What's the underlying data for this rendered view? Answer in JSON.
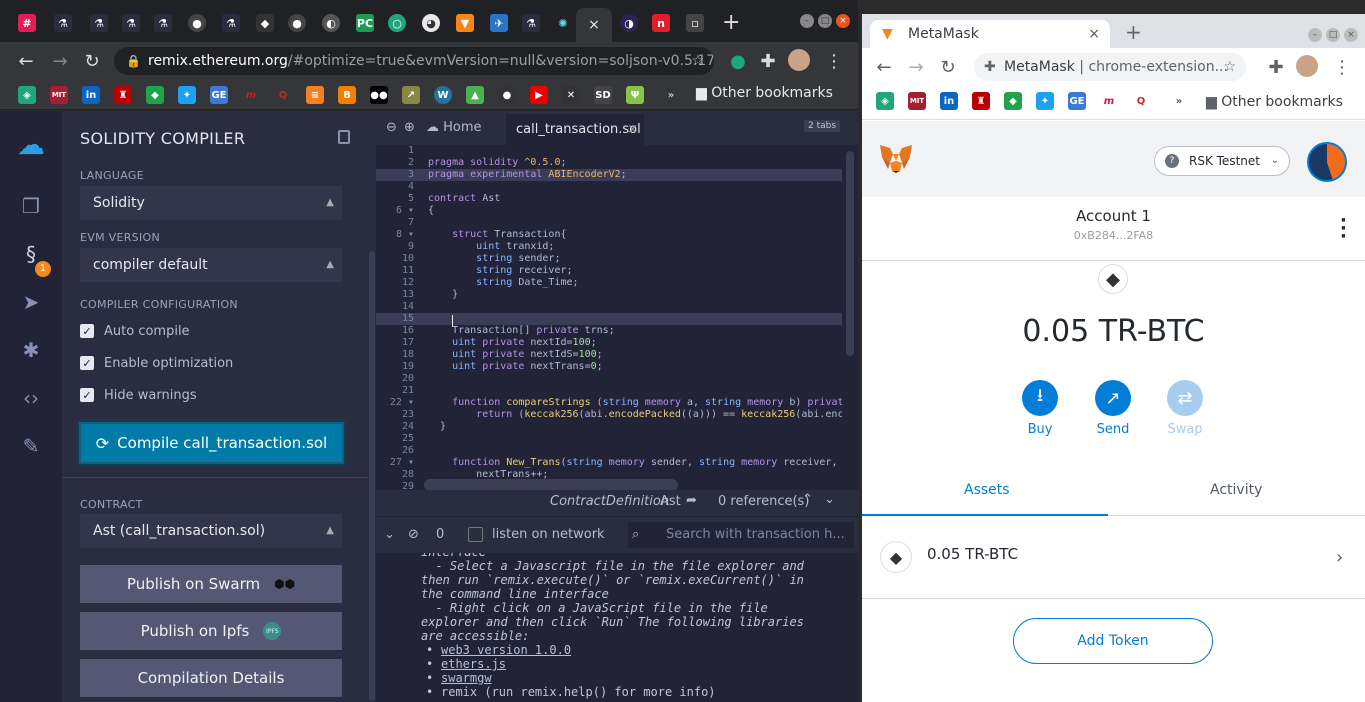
{
  "browser_left": {
    "url_domain": "remix.ethereum.org",
    "url_rest": "/#optimize=true&evmVersion=null&version=soljson-v0.5.17+...",
    "other_bookmarks": "Other bookmarks",
    "new_tab": "+",
    "close_tab": "×"
  },
  "remix": {
    "panel_title": "SOLIDITY COMPILER",
    "language_label": "LANGUAGE",
    "language_value": "Solidity",
    "evm_label": "EVM VERSION",
    "evm_value": "compiler default",
    "config_label": "COMPILER CONFIGURATION",
    "auto_compile": "Auto compile",
    "enable_optimization": "Enable optimization",
    "hide_warnings": "Hide warnings",
    "compile_button": "Compile call_transaction.sol",
    "contract_label": "CONTRACT",
    "contract_value": "Ast (call_transaction.sol)",
    "publish_swarm": "Publish on Swarm",
    "publish_ipfs": "Publish on Ipfs",
    "ipfs_badge": "IPFS",
    "compilation_details": "Compilation Details",
    "plugin_badge": "1"
  },
  "editor": {
    "home_tab": "Home",
    "file_tab": "call_transaction.sol",
    "tabs_count": "2 tabs",
    "contract_definition_label": "ContractDefinition",
    "contract_definition_name": "Ast",
    "references": "0 reference(s)",
    "terminal_count": "0",
    "listen_label": "listen on network",
    "search_placeholder": "Search with transaction h..."
  },
  "terminal_lines": [
    "interface",
    "  - Select a Javascript file in the file explorer and",
    "then run `remix.execute()` or `remix.exeCurrent()` in",
    "the command line interface",
    "  - Right click on a JavaScript file in the file",
    "explorer and then click `Run` The following libraries",
    "are accessible:",
    "web3 version 1.0.0",
    "ethers.js",
    "swarmgw",
    "remix (run remix.help() for more info)"
  ],
  "browser_right": {
    "tab_title": "MetaMask",
    "url_label": "MetaMask",
    "url_rest": "chrome-extension...",
    "other_bookmarks": "Other bookmarks",
    "close_tab": "×",
    "new_tab": "+"
  },
  "metamask": {
    "network": "RSK Testnet",
    "account_name": "Account 1",
    "account_address": "0xB284...2FA8",
    "balance": "0.05 TR-BTC",
    "buy": "Buy",
    "send": "Send",
    "swap": "Swap",
    "tab_assets": "Assets",
    "tab_activity": "Activity",
    "asset_name": "0.05 TR-BTC",
    "add_token": "Add Token"
  },
  "colors": {
    "remix_accent": "#007aa6",
    "metamask_blue": "#037dd6",
    "editor_bg": "#222336",
    "panel_bg": "#2a2c3f"
  }
}
